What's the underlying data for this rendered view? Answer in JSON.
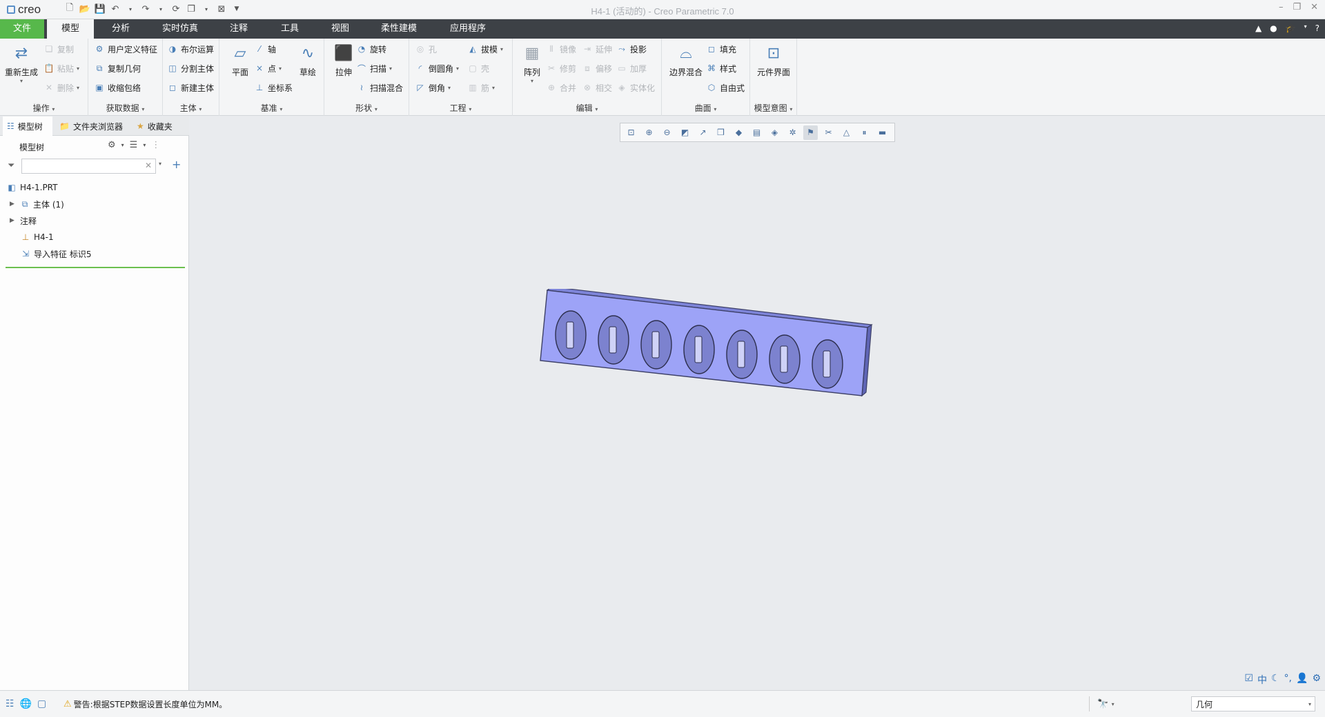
{
  "app": {
    "logo": "creo",
    "window_title": "H4-1 (活动的) - Creo Parametric 7.0"
  },
  "menu": {
    "tabs": [
      "文件",
      "模型",
      "分析",
      "实时仿真",
      "注释",
      "工具",
      "视图",
      "柔性建模",
      "应用程序"
    ]
  },
  "ribbon": {
    "operations": {
      "regenerate": "重新生成",
      "copy": "复制",
      "paste": "粘贴",
      "delete": "删除",
      "label": "操作"
    },
    "get_data": {
      "udf": "用户定义特征",
      "copy_geom": "复制几何",
      "shrinkwrap": "收缩包络",
      "label": "获取数据"
    },
    "body": {
      "boolean": "布尔运算",
      "split": "分割主体",
      "new_body": "新建主体",
      "label": "主体"
    },
    "datum": {
      "plane": "平面",
      "axis": "轴",
      "point": "点",
      "csys": "坐标系",
      "sketch": "草绘",
      "label": "基准"
    },
    "shapes": {
      "extrude": "拉伸",
      "revolve": "旋转",
      "sweep": "扫描",
      "swept_blend": "扫描混合",
      "label": "形状"
    },
    "engineering": {
      "hole": "孔",
      "draft": "拔模",
      "round": "倒圆角",
      "shell": "壳",
      "chamfer": "倒角",
      "rib": "筋",
      "label": "工程"
    },
    "editing": {
      "pattern": "阵列",
      "mirror": "镜像",
      "extend": "延伸",
      "project": "投影",
      "trim": "修剪",
      "offset": "偏移",
      "thicken": "加厚",
      "merge": "合并",
      "intersect": "相交",
      "solidify": "实体化",
      "label": "编辑"
    },
    "surfaces": {
      "boundary_blend": "边界混合",
      "fill": "填充",
      "style": "样式",
      "freestyle": "自由式",
      "label": "曲面"
    },
    "model_intent": {
      "component_interface": "元件界面",
      "label": "模型意图"
    }
  },
  "panel": {
    "tabs": [
      "模型树",
      "文件夹浏览器",
      "收藏夹"
    ],
    "tree_title": "模型树",
    "search_value": "",
    "tree": [
      {
        "label": "H4-1.PRT",
        "icon": "part-icon"
      },
      {
        "label": "主体 (1)",
        "icon": "body-icon"
      },
      {
        "label": "注释",
        "icon": "none"
      },
      {
        "label": "H4-1",
        "icon": "csys-icon"
      },
      {
        "label": "导入特征 标识5",
        "icon": "import-feature-icon"
      }
    ]
  },
  "status": {
    "message": "警告:根据STEP数据设置长度单位为MM。",
    "filter_selection": "几何"
  },
  "colors": {
    "file_tab": "#57b84b",
    "menubar": "#3d4146",
    "model_face": "#9da3f7",
    "tree_separator": "#6bbf4e"
  }
}
